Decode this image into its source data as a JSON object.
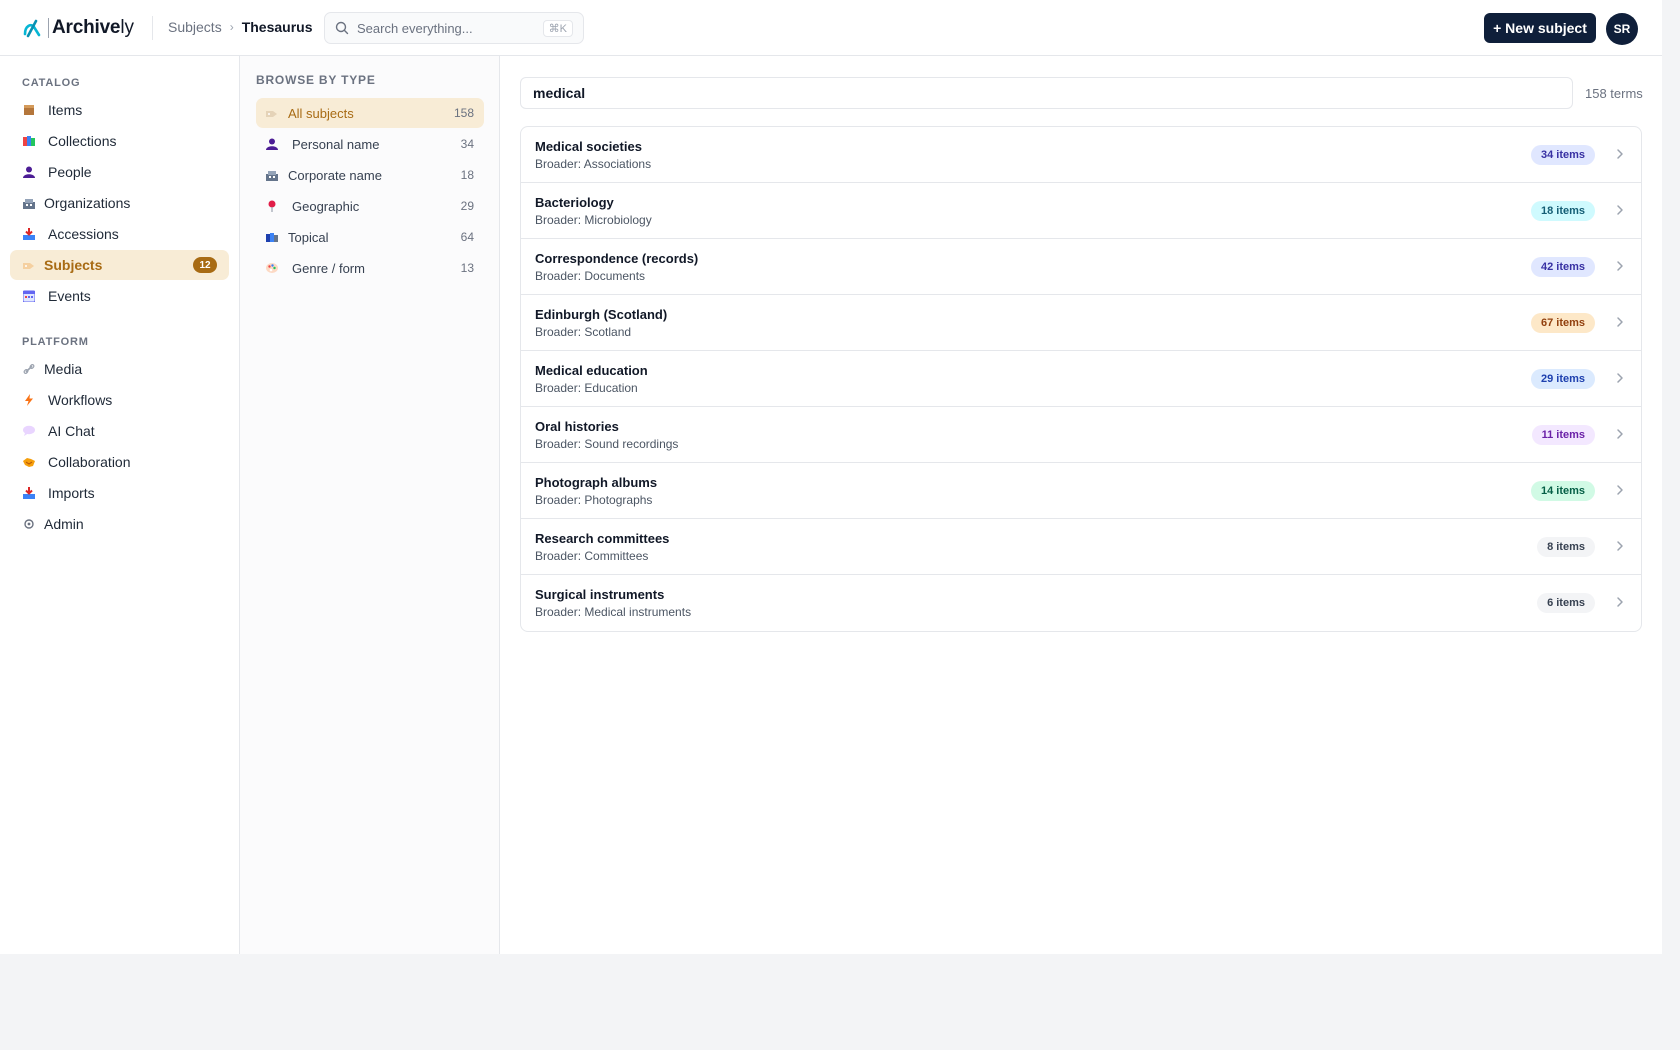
{
  "app": {
    "logo_text": "Archive",
    "logo_suffix": "ly"
  },
  "breadcrumb": {
    "parent": "Subjects",
    "separator": "›",
    "current": "Thesaurus"
  },
  "search": {
    "placeholder": "Search everything...",
    "shortcut": "⌘K"
  },
  "header": {
    "new_button": "+ New subject",
    "avatar_initials": "SR"
  },
  "sidebar": {
    "catalog_label": "CATALOG",
    "platform_label": "PLATFORM",
    "catalog_items": [
      {
        "label": "Items",
        "icon": "package-icon"
      },
      {
        "label": "Collections",
        "icon": "books-icon"
      },
      {
        "label": "People",
        "icon": "person-icon"
      },
      {
        "label": "Organizations",
        "icon": "building-icon"
      },
      {
        "label": "Accessions",
        "icon": "inbox-tray-icon"
      },
      {
        "label": "Subjects",
        "icon": "tag-icon",
        "badge": "12",
        "active": true
      },
      {
        "label": "Events",
        "icon": "calendar-icon"
      }
    ],
    "platform_items": [
      {
        "label": "Media",
        "icon": "link-icon"
      },
      {
        "label": "Workflows",
        "icon": "lightning-icon"
      },
      {
        "label": "AI Chat",
        "icon": "chat-bubble-icon"
      },
      {
        "label": "Collaboration",
        "icon": "handshake-icon"
      },
      {
        "label": "Imports",
        "icon": "inbox-tray-icon"
      },
      {
        "label": "Admin",
        "icon": "gear-icon"
      }
    ]
  },
  "types_panel": {
    "label": "BROWSE BY TYPE",
    "items": [
      {
        "label": "All subjects",
        "count": "158",
        "icon": "tag-icon",
        "active": true
      },
      {
        "label": "Personal name",
        "count": "34",
        "icon": "person-icon"
      },
      {
        "label": "Corporate name",
        "count": "18",
        "icon": "building-icon"
      },
      {
        "label": "Geographic",
        "count": "29",
        "icon": "pin-icon"
      },
      {
        "label": "Topical",
        "count": "64",
        "icon": "books-icon"
      },
      {
        "label": "Genre / form",
        "count": "13",
        "icon": "palette-icon"
      }
    ]
  },
  "main": {
    "filter_value": "medical",
    "term_count": "158 terms",
    "rows": [
      {
        "title": "Medical societies",
        "broader": "Broader: Associations",
        "items": "34 items",
        "color": "#e0e7ff",
        "text_color": "#3730a3"
      },
      {
        "title": "Bacteriology",
        "broader": "Broader: Microbiology",
        "items": "18 items",
        "color": "#cffafe",
        "text_color": "#155e75"
      },
      {
        "title": "Correspondence (records)",
        "broader": "Broader: Documents",
        "items": "42 items",
        "color": "#e0e7ff",
        "text_color": "#3730a3"
      },
      {
        "title": "Edinburgh (Scotland)",
        "broader": "Broader: Scotland",
        "items": "67 items",
        "color": "#fde8c8",
        "text_color": "#92400e"
      },
      {
        "title": "Medical education",
        "broader": "Broader: Education",
        "items": "29 items",
        "color": "#dbeafe",
        "text_color": "#1e40af"
      },
      {
        "title": "Oral histories",
        "broader": "Broader: Sound recordings",
        "items": "11 items",
        "color": "#f3e8ff",
        "text_color": "#6b21a8"
      },
      {
        "title": "Photograph albums",
        "broader": "Broader: Photographs",
        "items": "14 items",
        "color": "#d1fae5",
        "text_color": "#065f46"
      },
      {
        "title": "Research committees",
        "broader": "Broader: Committees",
        "items": "8 items",
        "color": "#f3f4f6",
        "text_color": "#374151"
      },
      {
        "title": "Surgical instruments",
        "broader": "Broader: Medical instruments",
        "items": "6 items",
        "color": "#f3f4f6",
        "text_color": "#374151"
      }
    ]
  }
}
